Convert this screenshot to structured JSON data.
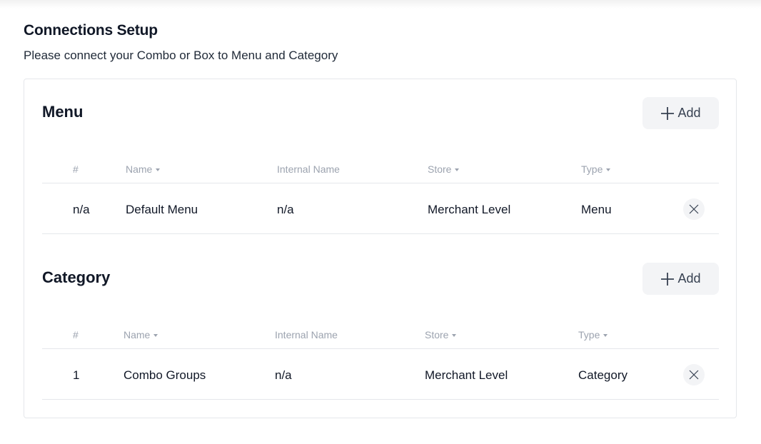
{
  "page": {
    "title": "Connections Setup",
    "subtitle": "Please connect your Combo or Box to Menu and Category"
  },
  "menu_section": {
    "title": "Menu",
    "add_label": "Add",
    "columns": [
      {
        "label": "#",
        "sortable": false
      },
      {
        "label": "Name",
        "sortable": true
      },
      {
        "label": "Internal Name",
        "sortable": false
      },
      {
        "label": "Store",
        "sortable": true
      },
      {
        "label": "Type",
        "sortable": true
      }
    ],
    "rows": [
      {
        "num": "n/a",
        "name": "Default Menu",
        "internal_name": "n/a",
        "store": "Merchant Level",
        "type": "Menu"
      }
    ]
  },
  "category_section": {
    "title": "Category",
    "add_label": "Add",
    "columns": [
      {
        "label": "#",
        "sortable": false
      },
      {
        "label": "Name",
        "sortable": true
      },
      {
        "label": "Internal Name",
        "sortable": false
      },
      {
        "label": "Store",
        "sortable": true
      },
      {
        "label": "Type",
        "sortable": true
      }
    ],
    "rows": [
      {
        "num": "1",
        "name": "Combo Groups",
        "internal_name": "n/a",
        "store": "Merchant Level",
        "type": "Category"
      }
    ]
  },
  "icons": {
    "add": "plus-icon",
    "remove": "close-icon",
    "sort": "caret-down-icon"
  },
  "colors": {
    "heading": "#111827",
    "header_text": "#9ca3af",
    "button_bg": "#f3f4f6",
    "border": "#e5e7eb"
  }
}
